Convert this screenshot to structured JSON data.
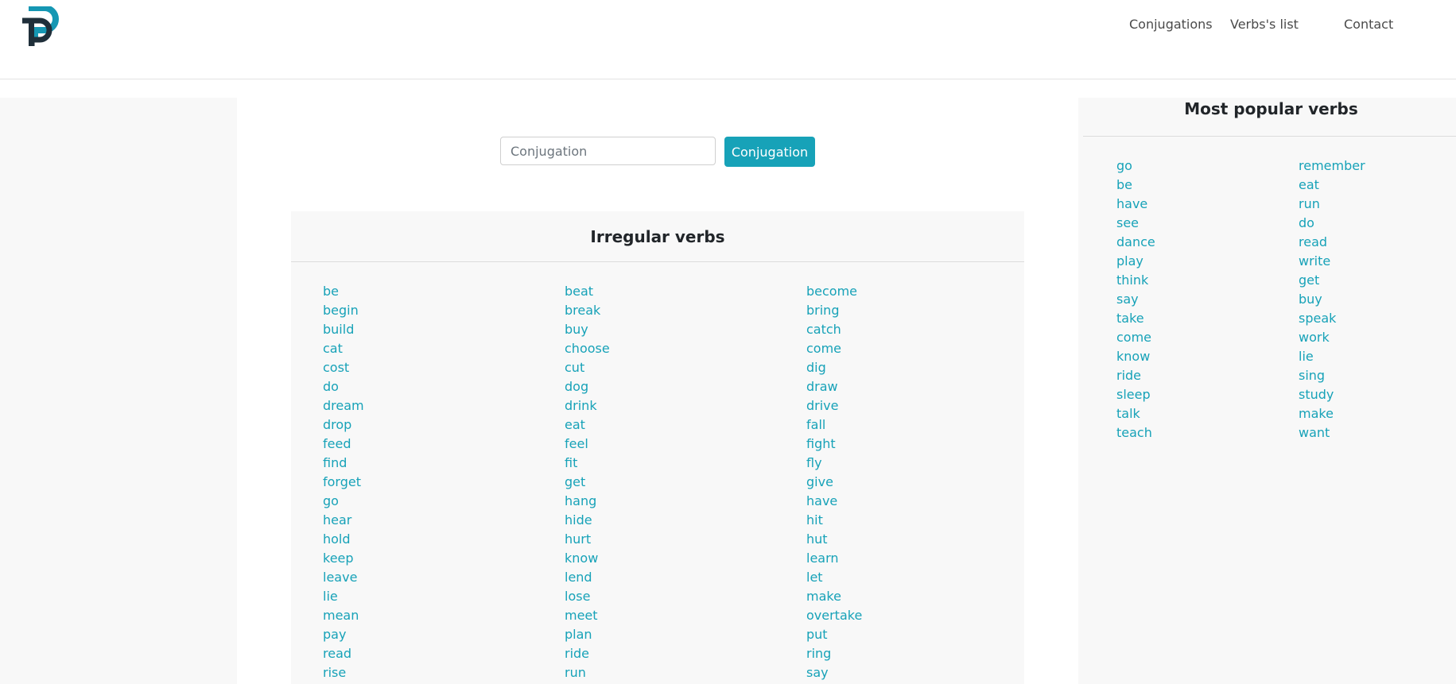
{
  "header": {
    "nav": [
      "Conjugations",
      "Verbs's list",
      "Contact"
    ]
  },
  "search": {
    "placeholder": "Conjugation",
    "button_label": "Conjugation"
  },
  "irregular": {
    "title": "Irregular verbs",
    "columns": [
      [
        "be",
        "begin",
        "build",
        "cat",
        "cost",
        "do",
        "dream",
        "drop",
        "feed",
        "find",
        "forget",
        "go",
        "hear",
        "hold",
        "keep",
        "leave",
        "lie",
        "mean",
        "pay",
        "read",
        "rise"
      ],
      [
        "beat",
        "break",
        "buy",
        "choose",
        "cut",
        "dog",
        "drink",
        "eat",
        "feel",
        "fit",
        "get",
        "hang",
        "hide",
        "hurt",
        "know",
        "lend",
        "lose",
        "meet",
        "plan",
        "ride",
        "run"
      ],
      [
        "become",
        "bring",
        "catch",
        "come",
        "dig",
        "draw",
        "drive",
        "fall",
        "fight",
        "fly",
        "give",
        "have",
        "hit",
        "hut",
        "learn",
        "let",
        "make",
        "overtake",
        "put",
        "ring",
        "say"
      ]
    ]
  },
  "popular": {
    "title": "Most popular verbs",
    "columns": [
      [
        "go",
        "be",
        "have",
        "see",
        "dance",
        "play",
        "think",
        "say",
        "take",
        "come",
        "know",
        "ride",
        "sleep",
        "talk",
        "teach"
      ],
      [
        "remember",
        "eat",
        "run",
        "do",
        "read",
        "write",
        "get",
        "buy",
        "speak",
        "work",
        "lie",
        "sing",
        "study",
        "make",
        "want"
      ]
    ]
  },
  "colors": {
    "accent": "#17a2b8",
    "logo_dark": "#1f2f3a",
    "logo_teal": "#1597b3"
  }
}
